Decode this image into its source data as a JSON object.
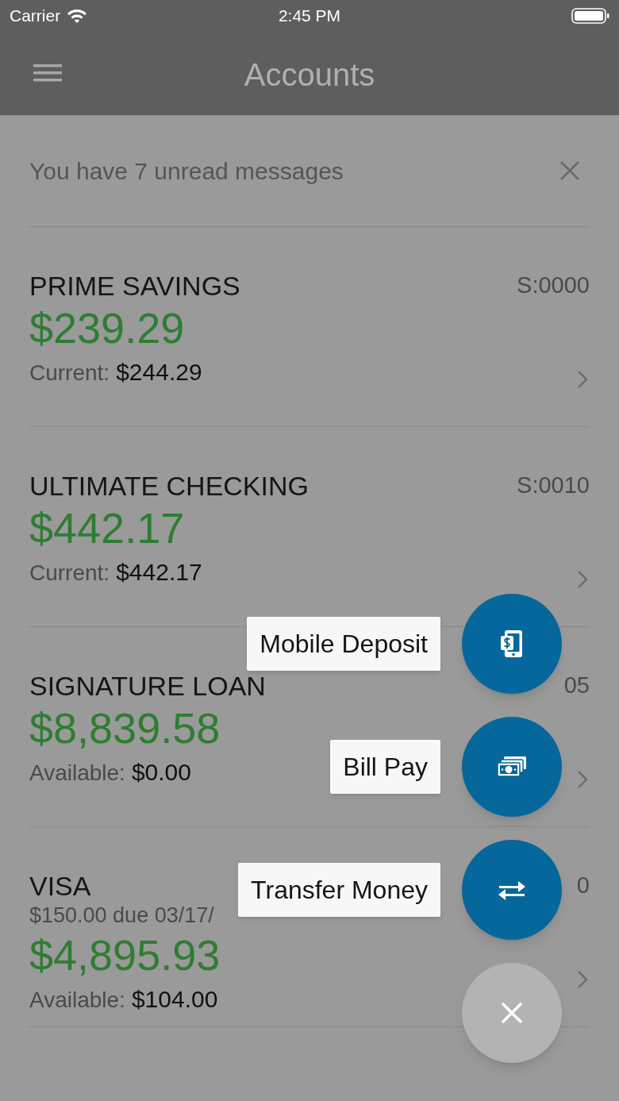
{
  "status_bar": {
    "carrier": "Carrier",
    "time": "2:45 PM"
  },
  "header": {
    "title": "Accounts"
  },
  "banner": {
    "text": "You have 7 unread messages"
  },
  "accounts": [
    {
      "name": "PRIME SAVINGS",
      "number": "S:0000",
      "balance": "$239.29",
      "detail_label": "Current:",
      "detail_value": "$244.29"
    },
    {
      "name": "ULTIMATE CHECKING",
      "number": "S:0010",
      "balance": "$442.17",
      "detail_label": "Current:",
      "detail_value": "$442.17"
    },
    {
      "name": "SIGNATURE LOAN",
      "number": "05",
      "balance": "$8,839.58",
      "detail_label": "Available:",
      "detail_value": "$0.00"
    },
    {
      "name": "VISA",
      "number": "0",
      "due": "$150.00 due 03/17/",
      "balance": "$4,895.93",
      "detail_label": "Available:",
      "detail_value": "$104.00"
    }
  ],
  "speed_dial": {
    "actions": [
      {
        "label": "Mobile Deposit",
        "kind": "deposit"
      },
      {
        "label": "Bill Pay",
        "kind": "bill"
      },
      {
        "label": "Transfer Money",
        "kind": "transfer"
      }
    ]
  }
}
